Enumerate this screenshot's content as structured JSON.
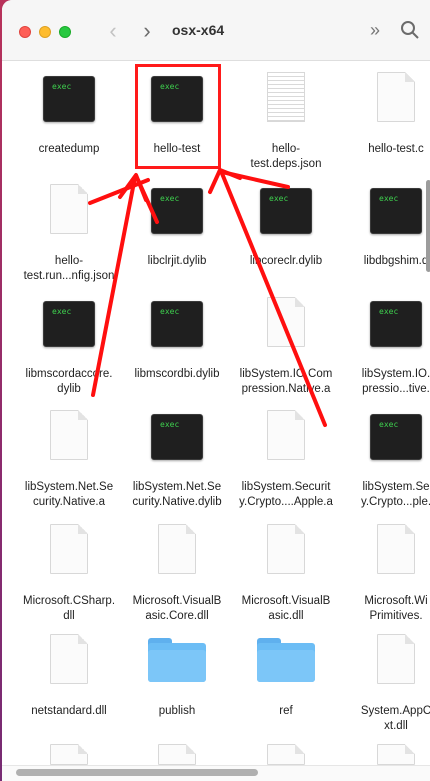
{
  "window": {
    "title": "osx-x64"
  },
  "toolbar": {
    "back_icon": "chevron-left-icon",
    "forward_icon": "chevron-right-icon",
    "more_icon": "double-chevron-icon",
    "search_icon": "search-icon"
  },
  "exec_badge": "exec",
  "rows": [
    [
      {
        "name": "createdump",
        "kind": "exec",
        "l1": "createdump",
        "l2": ""
      },
      {
        "name": "hello-test",
        "kind": "exec",
        "l1": "hello-test",
        "l2": ""
      },
      {
        "name": "hello-test-deps",
        "kind": "json",
        "l1": "hello-",
        "l2": "test.deps.json"
      },
      {
        "name": "hello-test-c",
        "kind": "doc",
        "l1": "hello-test.c",
        "l2": ""
      }
    ],
    [
      {
        "name": "hello-test-runtimeconfig",
        "kind": "doc",
        "l1": "hello-",
        "l2": "test.run...nfig.json"
      },
      {
        "name": "libclrjit",
        "kind": "exec",
        "l1": "libclrjit.dylib",
        "l2": ""
      },
      {
        "name": "libcoreclr",
        "kind": "exec",
        "l1": "libcoreclr.dylib",
        "l2": ""
      },
      {
        "name": "libdbgshim",
        "kind": "exec",
        "l1": "libdbgshim.d",
        "l2": ""
      }
    ],
    [
      {
        "name": "libmscordaccore",
        "kind": "exec",
        "l1": "libmscordaccore.",
        "l2": "dylib"
      },
      {
        "name": "libmscordbi",
        "kind": "exec",
        "l1": "libmscordbi.dylib",
        "l2": ""
      },
      {
        "name": "libSystem-IO-Compression",
        "kind": "doc",
        "l1": "libSystem.IO.Com",
        "l2": "pression.Native.a"
      },
      {
        "name": "libSystem-IO-Compression-2",
        "kind": "exec",
        "l1": "libSystem.IO.",
        "l2": "pressio...tive."
      }
    ],
    [
      {
        "name": "libSystem-Net-Security-a",
        "kind": "doc",
        "l1": "libSystem.Net.Se",
        "l2": "curity.Native.a"
      },
      {
        "name": "libSystem-Net-Security-dylib",
        "kind": "exec",
        "l1": "libSystem.Net.Se",
        "l2": "curity.Native.dylib"
      },
      {
        "name": "libSystem-Security-Crypto-a",
        "kind": "doc",
        "l1": "libSystem.Securit",
        "l2": "y.Crypto....Apple.a"
      },
      {
        "name": "libSystem-Security-Crypto-2",
        "kind": "exec",
        "l1": "libSystem.Se",
        "l2": "y.Crypto...ple."
      }
    ],
    [
      {
        "name": "Microsoft-CSharp",
        "kind": "doc",
        "l1": "Microsoft.CSharp.",
        "l2": "dll"
      },
      {
        "name": "Microsoft-VisualBasic-Core",
        "kind": "doc",
        "l1": "Microsoft.VisualB",
        "l2": "asic.Core.dll"
      },
      {
        "name": "Microsoft-VisualBasic",
        "kind": "doc",
        "l1": "Microsoft.VisualB",
        "l2": "asic.dll"
      },
      {
        "name": "Microsoft-Win-Primitives",
        "kind": "doc",
        "l1": "Microsoft.Wi",
        "l2": "Primitives."
      }
    ],
    [
      {
        "name": "netstandard",
        "kind": "doc",
        "l1": "netstandard.dll",
        "l2": ""
      },
      {
        "name": "publish",
        "kind": "folder",
        "l1": "publish",
        "l2": ""
      },
      {
        "name": "ref",
        "kind": "folder",
        "l1": "ref",
        "l2": ""
      },
      {
        "name": "System-AppContext",
        "kind": "doc",
        "l1": "System.AppC",
        "l2": "xt.dll"
      }
    ]
  ]
}
